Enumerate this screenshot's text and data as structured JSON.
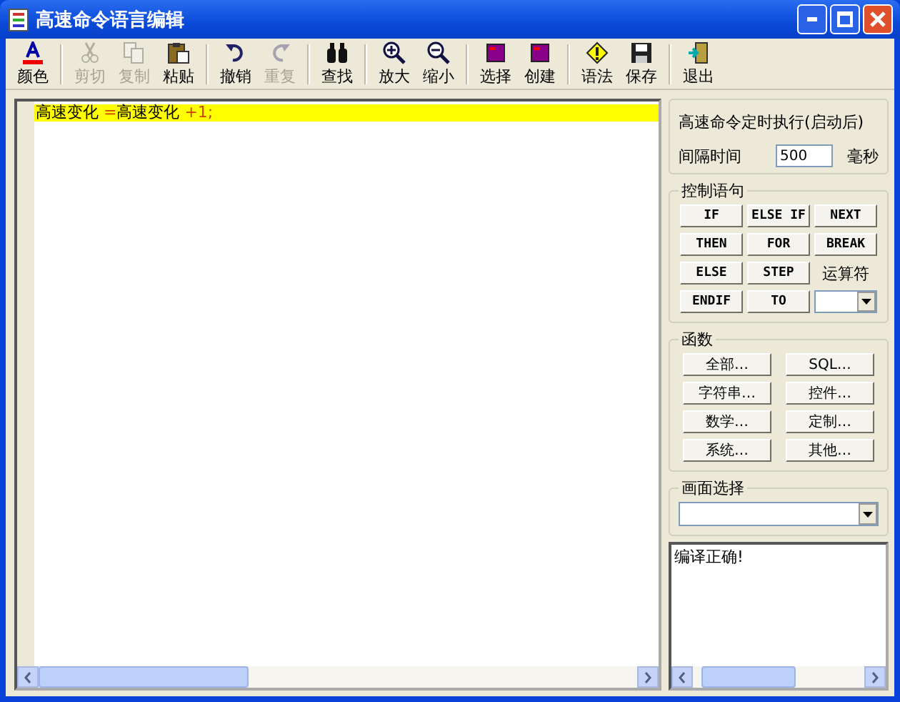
{
  "window": {
    "title": "高速命令语言编辑"
  },
  "toolbar": [
    [
      {
        "label": "颜色",
        "disabled": false
      }
    ],
    [
      {
        "label": "剪切",
        "disabled": true
      },
      {
        "label": "复制",
        "disabled": true
      },
      {
        "label": "粘贴",
        "disabled": false
      }
    ],
    [
      {
        "label": "撤销",
        "disabled": false
      },
      {
        "label": "重复",
        "disabled": true
      }
    ],
    [
      {
        "label": "查找",
        "disabled": false
      }
    ],
    [
      {
        "label": "放大",
        "disabled": false
      },
      {
        "label": "缩小",
        "disabled": false
      }
    ],
    [
      {
        "label": "选择",
        "disabled": false
      },
      {
        "label": "创建",
        "disabled": false
      }
    ],
    [
      {
        "label": "语法",
        "disabled": false
      },
      {
        "label": "保存",
        "disabled": false
      }
    ],
    [
      {
        "label": "退出",
        "disabled": false
      }
    ]
  ],
  "editor": {
    "lines": [
      {
        "highlighted": true,
        "segments": [
          {
            "text": "高速变化 ",
            "kind": "name"
          },
          {
            "text": "=",
            "kind": "operator"
          },
          {
            "text": "高速变化 ",
            "kind": "name"
          },
          {
            "text": "+1;",
            "kind": "operator"
          }
        ]
      }
    ]
  },
  "timer": {
    "title": "高速命令定时执行(启动后)",
    "interval_label": "间隔时间",
    "interval_value": "500",
    "unit": "毫秒"
  },
  "control": {
    "title": "控制语句",
    "buttons": [
      "IF",
      "ELSE IF",
      "NEXT",
      "THEN",
      "FOR",
      "BREAK",
      "ELSE",
      "STEP",
      "ENDIF",
      "TO"
    ],
    "operator_label": "运算符"
  },
  "functions": {
    "title": "函数",
    "buttons": [
      "全部…",
      "SQL…",
      "字符串…",
      "控件…",
      "数学…",
      "定制…",
      "系统…",
      "其他…"
    ]
  },
  "screen_select": {
    "title": "画面选择"
  },
  "output": {
    "text": "编译正确!"
  }
}
